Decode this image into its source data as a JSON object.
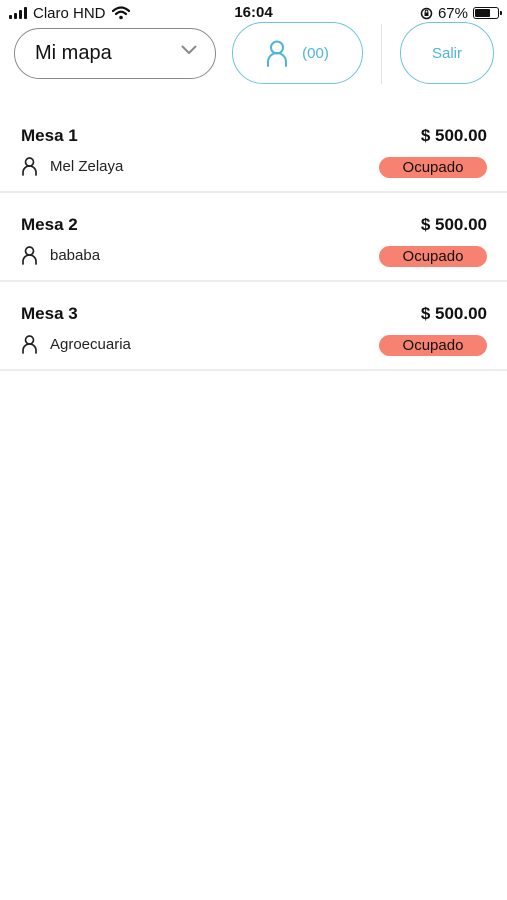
{
  "status_bar": {
    "carrier": "Claro HND",
    "time": "16:04",
    "battery": "67%",
    "battery_level": 0.67
  },
  "toolbar": {
    "map_select_value": "Mi mapa",
    "people_count": "(00)",
    "exit_label": "Salir"
  },
  "colors": {
    "accent": "#4fb4da",
    "status_occupied": "#f88272"
  },
  "tables": [
    {
      "name": "Mesa 1",
      "price": "$ 500.00",
      "customer": "Mel Zelaya",
      "status": "Ocupado"
    },
    {
      "name": "Mesa 2",
      "price": "$ 500.00",
      "customer": "bababa",
      "status": "Ocupado"
    },
    {
      "name": "Mesa 3",
      "price": "$ 500.00",
      "customer": "Agroecuaria",
      "status": "Ocupado"
    }
  ]
}
